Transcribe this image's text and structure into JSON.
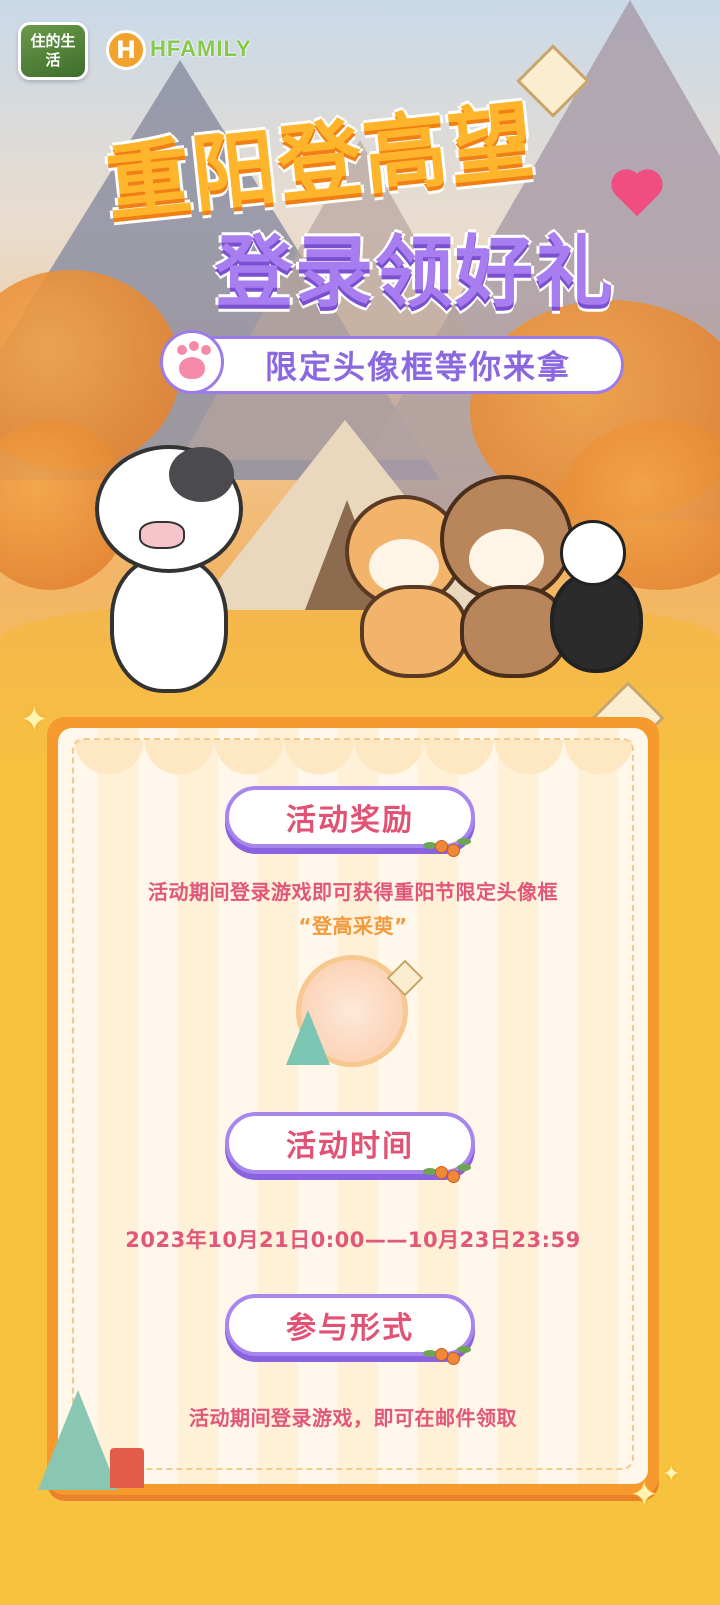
{
  "logos": {
    "game_logo_text": "住的生活",
    "brand_mark": "H",
    "brand_text": "HFAMILY"
  },
  "hero": {
    "title_line1": "重阳登高望",
    "title_line2": "登录领好礼",
    "subtitle": "限定头像框等你来拿",
    "icons": [
      "paw-icon",
      "heart-icon",
      "kite-icon"
    ]
  },
  "sections": {
    "reward": {
      "heading": "活动奖励",
      "text": "活动期间登录游戏即可获得重阳节限定头像框",
      "highlight": "“登高采萸”"
    },
    "time": {
      "heading": "活动时间",
      "text": "2023年10月21日0:00——10月23日23:59"
    },
    "participation": {
      "heading": "参与形式",
      "text": "活动期间登录游戏，即可在邮件领取"
    }
  },
  "colors": {
    "background": "#f7c23e",
    "card_border": "#f79a2d",
    "accent_purple": "#a886ee",
    "accent_pink": "#e25274",
    "title_orange": "#ffb52b"
  }
}
